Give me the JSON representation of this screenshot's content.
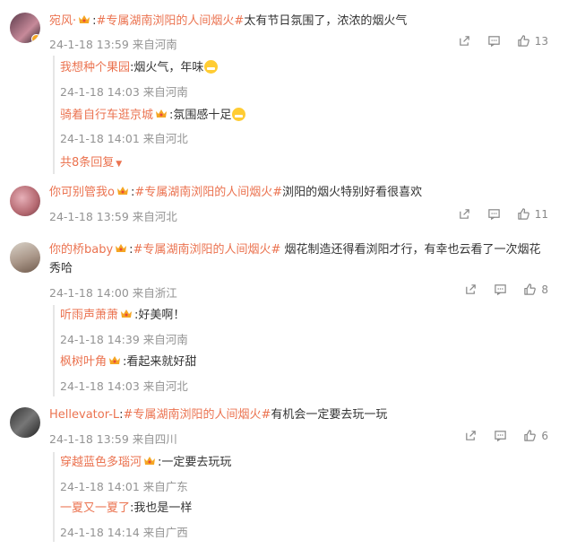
{
  "comments": [
    {
      "user": "宛风·",
      "sep": ":",
      "tag": "#专属湖南浏阳的人间烟火#",
      "text": "太有节日氛围了，浓浓的烟火气",
      "time": "24-1-18 13:59",
      "location": "来自河南",
      "likes": "13",
      "replies": [
        {
          "user": "我想种个果园",
          "text": ":烟火气，年味",
          "time": "24-1-18 14:03",
          "location": "来自河南"
        },
        {
          "user": "骑着自行车逛京城",
          "text": ":氛围感十足",
          "time": "24-1-18 14:01",
          "location": "来自河北"
        }
      ],
      "more": "共8条回复"
    },
    {
      "user": "你可别管我o",
      "sep": ":",
      "tag": "#专属湖南浏阳的人间烟火#",
      "text": "浏阳的烟火特别好看很喜欢",
      "time": "24-1-18 13:59",
      "location": "来自河北",
      "likes": "11"
    },
    {
      "user": "你的桥baby",
      "sep": ":",
      "tag": "#专属湖南浏阳的人间烟火#",
      "text": " 烟花制造还得看浏阳才行，有幸也云看了一次烟花",
      "text2": "秀哈",
      "time": "24-1-18 14:00",
      "location": "来自浙江",
      "likes": "8",
      "replies": [
        {
          "user": "听雨声萧萧",
          "text": ":好美啊！",
          "time": "24-1-18 14:39",
          "location": "来自河南"
        },
        {
          "user": "枫树叶角",
          "text": ":看起来就好甜",
          "time": "24-1-18 14:03",
          "location": "来自河北"
        }
      ]
    },
    {
      "user": "Hellevator-L",
      "sep": ":",
      "tag": "#专属湖南浏阳的人间烟火#",
      "text": "有机会一定要去玩一玩",
      "time": "24-1-18 13:59",
      "location": "来自四川",
      "likes": "6",
      "replies": [
        {
          "user": "穿越蓝色多瑙河",
          "text": ":一定要去玩玩",
          "time": "24-1-18 14:01",
          "location": "来自广东"
        },
        {
          "user": "一夏又一夏了",
          "text": ":我也是一样",
          "time": "24-1-18 14:14",
          "location": "来自广西"
        }
      ]
    }
  ],
  "colors": {
    "accent": "#eb7350",
    "meta": "#939393"
  },
  "icons": [
    "share-icon",
    "comment-icon",
    "like-icon",
    "crown-badge-icon",
    "vip-badge-icon"
  ]
}
